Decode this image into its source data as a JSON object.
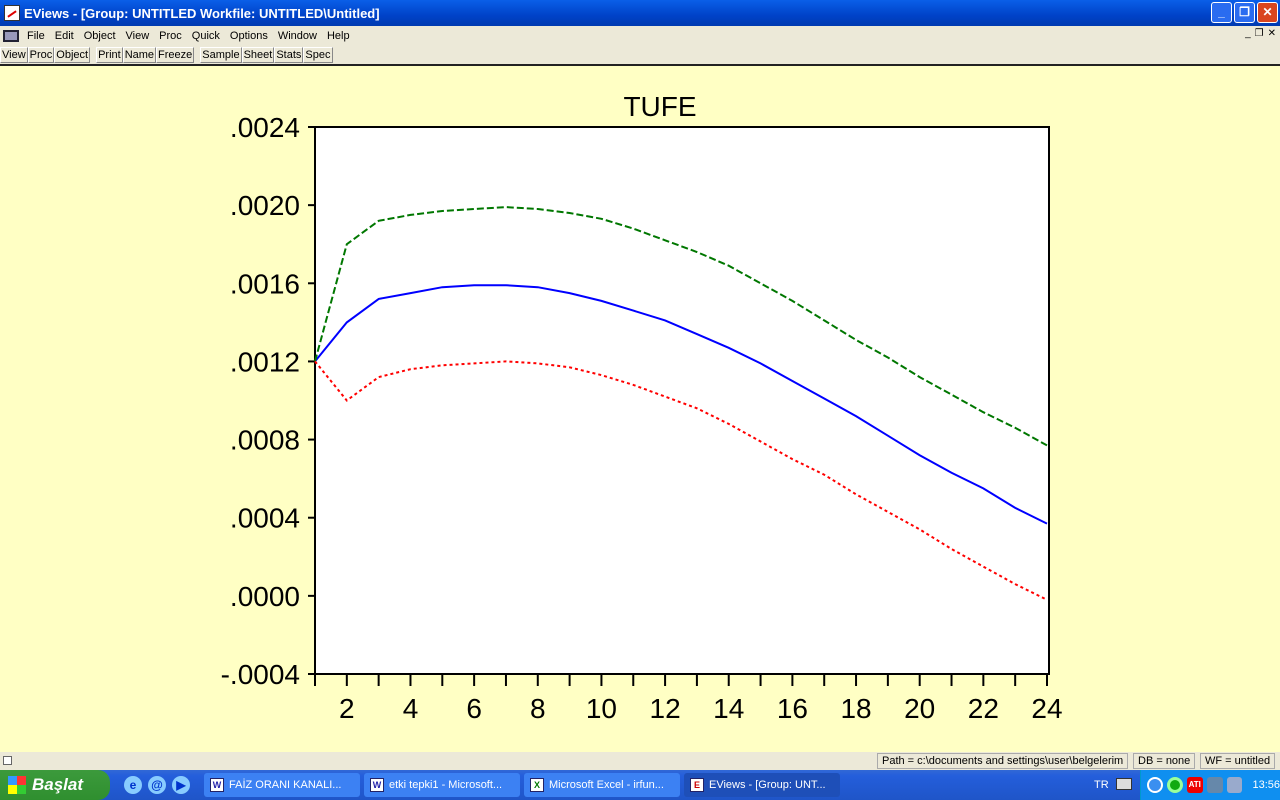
{
  "window": {
    "title": "EViews - [Group: UNTITLED   Workfile: UNTITLED\\Untitled]",
    "buttons": {
      "minimize": "_",
      "restore": "❐",
      "close": "✕"
    }
  },
  "menu": [
    "File",
    "Edit",
    "Object",
    "View",
    "Proc",
    "Quick",
    "Options",
    "Window",
    "Help"
  ],
  "mdi_buttons": [
    "_",
    "❐",
    "✕"
  ],
  "toolbar": [
    [
      "View",
      "Proc",
      "Object"
    ],
    [
      "Print",
      "Name",
      "Freeze"
    ],
    [
      "Sample",
      "Sheet",
      "Stats",
      "Spec"
    ]
  ],
  "status": {
    "path": "Path = c:\\documents and settings\\user\\belgelerim",
    "db": "DB = none",
    "wf": "WF = untitled"
  },
  "taskbar": {
    "start": "Başlat",
    "tasks": [
      {
        "label": "FAİZ ORANI KANALI...",
        "icon": "word-icon"
      },
      {
        "label": "etki tepki1 - Microsoft...",
        "icon": "word-icon"
      },
      {
        "label": "Microsoft Excel - irfun...",
        "icon": "excel-icon"
      },
      {
        "label": "EViews - [Group: UNT...",
        "icon": "eviews-icon",
        "active": true
      }
    ],
    "lang": "TR",
    "clock": "13:56"
  },
  "chart_data": {
    "type": "line",
    "title": "TUFE",
    "xlabel": "",
    "ylabel": "",
    "x": [
      1,
      2,
      3,
      4,
      5,
      6,
      7,
      8,
      9,
      10,
      11,
      12,
      13,
      14,
      15,
      16,
      17,
      18,
      19,
      20,
      21,
      22,
      23,
      24
    ],
    "xlim": [
      1,
      24
    ],
    "ylim": [
      -0.0004,
      0.0024
    ],
    "xticks": [
      2,
      4,
      6,
      8,
      10,
      12,
      14,
      16,
      18,
      20,
      22,
      24
    ],
    "yticks": [
      -0.0004,
      0.0,
      0.0004,
      0.0008,
      0.0012,
      0.0016,
      0.002,
      0.0024
    ],
    "ytick_labels": [
      "-.0004",
      ".0000",
      ".0004",
      ".0008",
      ".0012",
      ".0016",
      ".0020",
      ".0024"
    ],
    "grid": false,
    "series": [
      {
        "color": "#0000ff",
        "style": "solid",
        "values": [
          0.0012,
          0.0014,
          0.00152,
          0.00155,
          0.00158,
          0.00159,
          0.00159,
          0.00158,
          0.00155,
          0.00151,
          0.00146,
          0.00141,
          0.00134,
          0.00127,
          0.00119,
          0.0011,
          0.00101,
          0.00092,
          0.00082,
          0.00072,
          0.00063,
          0.00055,
          0.00045,
          0.00037
        ]
      },
      {
        "color": "#007700",
        "style": "dashed",
        "values": [
          0.0012,
          0.0018,
          0.00192,
          0.00195,
          0.00197,
          0.00198,
          0.00199,
          0.00198,
          0.00196,
          0.00193,
          0.00188,
          0.00182,
          0.00176,
          0.00169,
          0.0016,
          0.00151,
          0.00141,
          0.00131,
          0.00122,
          0.00112,
          0.00103,
          0.00094,
          0.00086,
          0.00077
        ]
      },
      {
        "color": "#ff0000",
        "style": "dotted",
        "values": [
          0.0012,
          0.001,
          0.00112,
          0.00116,
          0.00118,
          0.00119,
          0.0012,
          0.00119,
          0.00117,
          0.00113,
          0.00108,
          0.00102,
          0.00096,
          0.00088,
          0.00079,
          0.0007,
          0.00062,
          0.00052,
          0.00043,
          0.00034,
          0.00024,
          0.00015,
          6e-05,
          -2e-05
        ]
      }
    ]
  }
}
